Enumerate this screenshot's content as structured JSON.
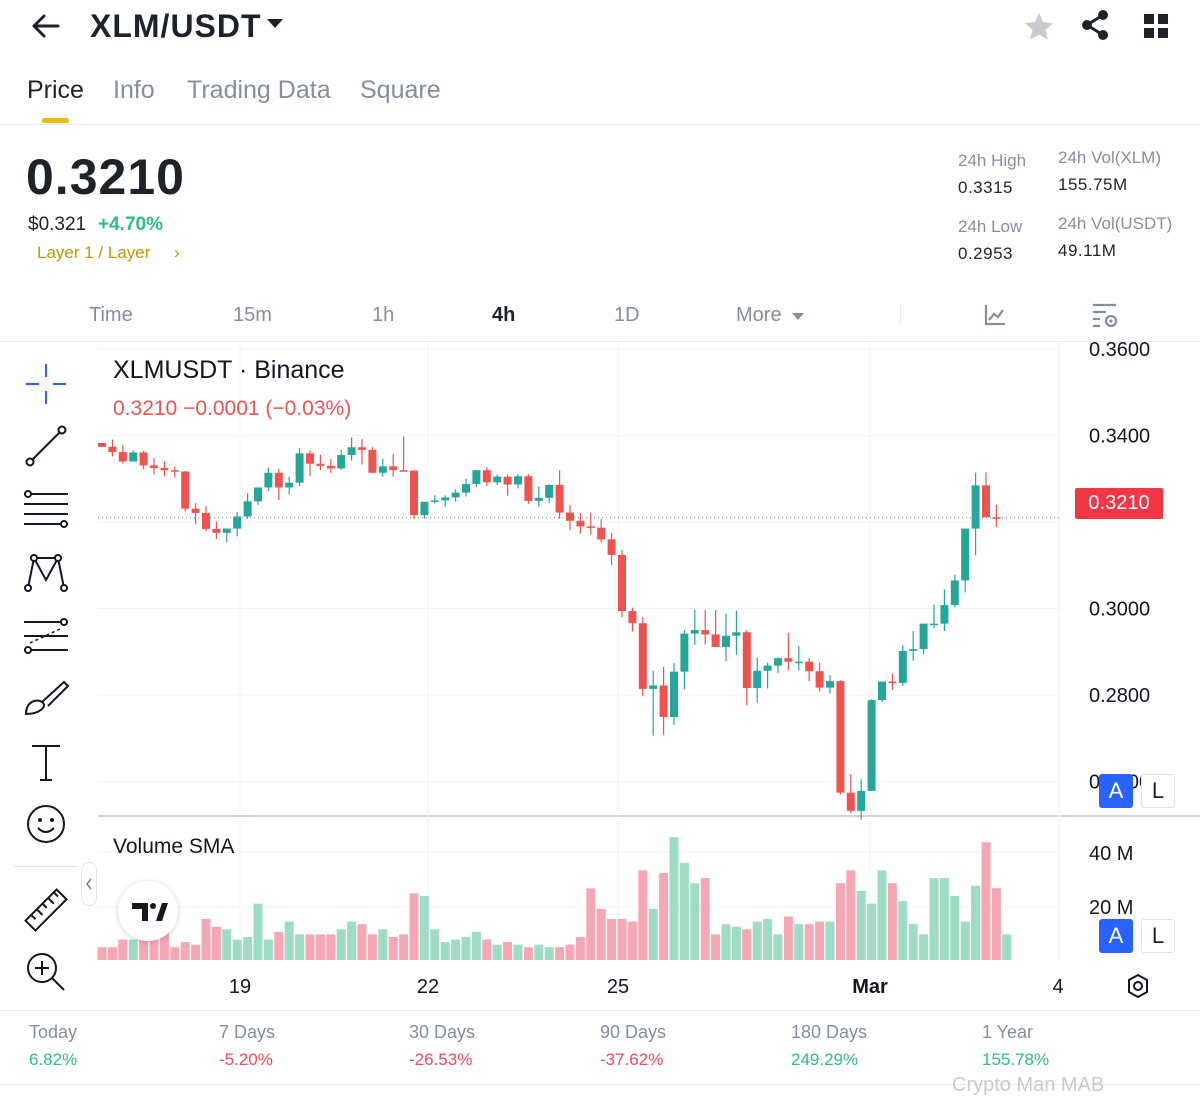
{
  "header": {
    "pair": "XLM/USDT",
    "tabs": [
      {
        "label": "Price"
      },
      {
        "label": "Info"
      },
      {
        "label": "Trading Data"
      },
      {
        "label": "Square"
      }
    ]
  },
  "ticker": {
    "last_price": "0.3210",
    "usd_price": "$0.321",
    "change_pct": "+4.70%",
    "tag": "Layer 1 / Layer",
    "tag_chevron": "›",
    "stats": {
      "high_label": "24h High",
      "high_value": "0.3315",
      "low_label": "24h Low",
      "low_value": "0.2953",
      "vol_base_label": "24h Vol(XLM)",
      "vol_base_value": "155.75M",
      "vol_quote_label": "24h Vol(USDT)",
      "vol_quote_value": "49.11M"
    }
  },
  "timeframes": [
    {
      "label": "Time"
    },
    {
      "label": "15m"
    },
    {
      "label": "1h"
    },
    {
      "label": "4h"
    },
    {
      "label": "1D"
    },
    {
      "label": "More"
    }
  ],
  "chart": {
    "symbol_title": "XLMUSDT · Binance",
    "ohlc_readout": "0.3210  −0.0001 (−0.03%)",
    "volume_title": "Volume SMA",
    "current_price_tag": "0.3210",
    "price_axis": [
      "0.3600",
      "0.3400",
      "0.3000",
      "0.2800",
      "0.2600"
    ],
    "volume_axis": [
      "40 M",
      "20 M"
    ],
    "time_axis": [
      "19",
      "22",
      "25",
      "Mar",
      "4"
    ],
    "auto_scale_label": "A",
    "log_scale_label": "L",
    "colors": {
      "up": "#26a69a",
      "down": "#ef5350",
      "up_vol": "#9fdcc4",
      "down_vol": "#f5a7b3"
    }
  },
  "chart_data": {
    "type": "candlestick",
    "title": "XLMUSDT · Binance",
    "ylim": [
      0.252,
      0.3605
    ],
    "x_ticks": [
      "19",
      "22",
      "25",
      "Mar",
      "4"
    ],
    "candles": [
      [
        0.3383,
        0.3383,
        0.3375,
        0.3374
      ],
      [
        0.3374,
        0.3391,
        0.3352,
        0.3362
      ],
      [
        0.3362,
        0.3378,
        0.3335,
        0.334
      ],
      [
        0.334,
        0.3366,
        0.334,
        0.3361
      ],
      [
        0.3361,
        0.3365,
        0.3322,
        0.3331
      ],
      [
        0.3331,
        0.3348,
        0.331,
        0.3325
      ],
      [
        0.3325,
        0.334,
        0.3306,
        0.332
      ],
      [
        0.332,
        0.3328,
        0.3303,
        0.3317
      ],
      [
        0.3317,
        0.3318,
        0.3225,
        0.3231
      ],
      [
        0.3231,
        0.3244,
        0.3195,
        0.3221
      ],
      [
        0.3221,
        0.3237,
        0.3179,
        0.3184
      ],
      [
        0.3184,
        0.3201,
        0.3161,
        0.3175
      ],
      [
        0.3175,
        0.3177,
        0.3154,
        0.3185
      ],
      [
        0.3185,
        0.3223,
        0.3167,
        0.3213
      ],
      [
        0.3213,
        0.3267,
        0.3208,
        0.3248
      ],
      [
        0.3248,
        0.3276,
        0.324,
        0.328
      ],
      [
        0.328,
        0.3326,
        0.3272,
        0.3314
      ],
      [
        0.3314,
        0.3323,
        0.3251,
        0.328
      ],
      [
        0.328,
        0.3305,
        0.3264,
        0.3291
      ],
      [
        0.3291,
        0.3371,
        0.3283,
        0.3359
      ],
      [
        0.3359,
        0.3366,
        0.3306,
        0.3335
      ],
      [
        0.3335,
        0.3356,
        0.332,
        0.333
      ],
      [
        0.333,
        0.3346,
        0.3314,
        0.3324
      ],
      [
        0.3324,
        0.3367,
        0.3321,
        0.3355
      ],
      [
        0.3355,
        0.3396,
        0.3342,
        0.3373
      ],
      [
        0.3373,
        0.3392,
        0.3333,
        0.3367
      ],
      [
        0.3367,
        0.3373,
        0.3314,
        0.3314
      ],
      [
        0.3314,
        0.3347,
        0.3305,
        0.3329
      ],
      [
        0.3329,
        0.3358,
        0.3305,
        0.332
      ],
      [
        0.332,
        0.3398,
        0.3317,
        0.3319
      ],
      [
        0.3319,
        0.3321,
        0.3207,
        0.3216
      ],
      [
        0.3216,
        0.3244,
        0.3208,
        0.3247
      ],
      [
        0.3247,
        0.3262,
        0.3243,
        0.325
      ],
      [
        0.325,
        0.3262,
        0.3236,
        0.3257
      ],
      [
        0.3257,
        0.3276,
        0.3247,
        0.3268
      ],
      [
        0.3268,
        0.33,
        0.3259,
        0.3288
      ],
      [
        0.3288,
        0.332,
        0.3281,
        0.332
      ],
      [
        0.332,
        0.3327,
        0.3283,
        0.3292
      ],
      [
        0.3292,
        0.331,
        0.3286,
        0.3305
      ],
      [
        0.3305,
        0.331,
        0.3261,
        0.3287
      ],
      [
        0.3287,
        0.3311,
        0.3278,
        0.3306
      ],
      [
        0.3306,
        0.3311,
        0.3242,
        0.3249
      ],
      [
        0.3249,
        0.3283,
        0.3236,
        0.3256
      ],
      [
        0.3256,
        0.3287,
        0.3244,
        0.3286
      ],
      [
        0.3286,
        0.332,
        0.3208,
        0.3222
      ],
      [
        0.3222,
        0.3239,
        0.3181,
        0.3203
      ],
      [
        0.3203,
        0.3221,
        0.3173,
        0.319
      ],
      [
        0.319,
        0.3222,
        0.3171,
        0.3187
      ],
      [
        0.3187,
        0.3207,
        0.3153,
        0.316
      ],
      [
        0.316,
        0.3175,
        0.3101,
        0.3124
      ],
      [
        0.3124,
        0.3135,
        0.298,
        0.2994
      ],
      [
        0.2994,
        0.3002,
        0.2947,
        0.2966
      ],
      [
        0.2966,
        0.2981,
        0.2797,
        0.2814
      ],
      [
        0.2814,
        0.2856,
        0.2706,
        0.2822
      ],
      [
        0.2822,
        0.2865,
        0.2707,
        0.2749
      ],
      [
        0.2749,
        0.2874,
        0.2731,
        0.2854
      ],
      [
        0.2854,
        0.295,
        0.2813,
        0.2942
      ],
      [
        0.2942,
        0.2997,
        0.2916,
        0.295
      ],
      [
        0.295,
        0.2997,
        0.2917,
        0.294
      ],
      [
        0.294,
        0.2997,
        0.2921,
        0.2911
      ],
      [
        0.2911,
        0.2988,
        0.2878,
        0.2937
      ],
      [
        0.2937,
        0.2995,
        0.2893,
        0.2945
      ],
      [
        0.2945,
        0.295,
        0.2776,
        0.2816
      ],
      [
        0.2816,
        0.2886,
        0.2782,
        0.2856
      ],
      [
        0.2856,
        0.2875,
        0.2815,
        0.2868
      ],
      [
        0.2868,
        0.2887,
        0.2851,
        0.2885
      ],
      [
        0.2885,
        0.2943,
        0.2857,
        0.2877
      ],
      [
        0.2877,
        0.2913,
        0.2857,
        0.2877
      ],
      [
        0.2877,
        0.2886,
        0.2832,
        0.2855
      ],
      [
        0.2855,
        0.2875,
        0.2808,
        0.2817
      ],
      [
        0.2817,
        0.2846,
        0.2803,
        0.2832
      ],
      [
        0.2832,
        0.2834,
        0.257,
        0.2574
      ],
      [
        0.2574,
        0.2617,
        0.2526,
        0.2532
      ],
      [
        0.2532,
        0.2605,
        0.2512,
        0.2578
      ],
      [
        0.2578,
        0.279,
        0.2578,
        0.2788
      ],
      [
        0.2788,
        0.2812,
        0.2784,
        0.2831
      ],
      [
        0.2831,
        0.285,
        0.2812,
        0.2828
      ],
      [
        0.2828,
        0.2915,
        0.2821,
        0.2902
      ],
      [
        0.2902,
        0.2948,
        0.2879,
        0.2906
      ],
      [
        0.2906,
        0.2963,
        0.2894,
        0.2965
      ],
      [
        0.2965,
        0.3009,
        0.2954,
        0.2965
      ],
      [
        0.2965,
        0.3044,
        0.2948,
        0.3008
      ],
      [
        0.3008,
        0.3078,
        0.3003,
        0.3065
      ],
      [
        0.3065,
        0.3142,
        0.3037,
        0.3185
      ],
      [
        0.3185,
        0.3314,
        0.3123,
        0.3285
      ],
      [
        0.3285,
        0.3315,
        0.3214,
        0.3211
      ],
      [
        0.3211,
        0.324,
        0.3189,
        0.321
      ]
    ],
    "volume": [
      5,
      5,
      8,
      8,
      8,
      10,
      12,
      5,
      7,
      6,
      16,
      13,
      12,
      8,
      9,
      22,
      8,
      11,
      15,
      10,
      10,
      10,
      10,
      12,
      15,
      14,
      10,
      12,
      9,
      10,
      26,
      25,
      12,
      7,
      8,
      9,
      11,
      8,
      6,
      7,
      6,
      5,
      6,
      5,
      5,
      6,
      9,
      28,
      20,
      16,
      16,
      15,
      35,
      20,
      34,
      48,
      38,
      30,
      32,
      10,
      14,
      13,
      12,
      15,
      16,
      10,
      17,
      14,
      14,
      15,
      15,
      30,
      35,
      27,
      22,
      35,
      30,
      23,
      14,
      10,
      32,
      32,
      25,
      15,
      29,
      46,
      28,
      10
    ],
    "volume_units": "M"
  },
  "performance": [
    {
      "label": "Today",
      "value": "6.82%",
      "color": "#2ebd85"
    },
    {
      "label": "7 Days",
      "value": "-5.20%",
      "color": "#f6465d"
    },
    {
      "label": "30 Days",
      "value": "-26.53%",
      "color": "#f6465d"
    },
    {
      "label": "90 Days",
      "value": "-37.62%",
      "color": "#f6465d"
    },
    {
      "label": "180 Days",
      "value": "249.29%",
      "color": "#2ebd85"
    },
    {
      "label": "1 Year",
      "value": "155.78%",
      "color": "#2ebd85"
    }
  ],
  "watermark": "Crypto Man MAB"
}
